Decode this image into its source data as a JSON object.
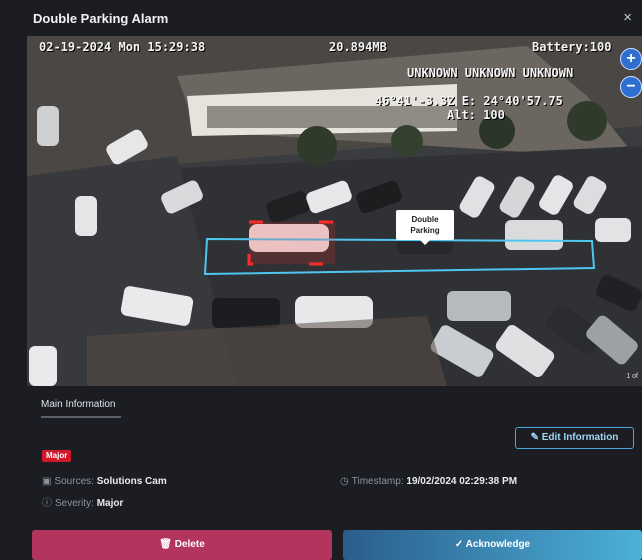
{
  "window": {
    "title": "Double Parking Alarm",
    "close_label": "×"
  },
  "camera": {
    "osd_datetime": "02-19-2024 Mon 15:29:38",
    "osd_size": "20.894MB",
    "osd_battery": "Battery:100",
    "osd_status": "UNKNOWN UNKNOWN UNKNOWN",
    "osd_coords": "46°41'-3.3Z E: 24°40'57.75",
    "osd_alt": "Alt: 100",
    "zoom_in": "+",
    "zoom_out": "−",
    "page_indicator": "1 of",
    "detection_label": "Double Parking",
    "highlight_color": "#ff2b2b",
    "zone_color": "#4fc6f0"
  },
  "tabs": {
    "main_info": "Main Information"
  },
  "actions": {
    "edit": "Edit Information",
    "delete": "Delete",
    "acknowledge": "Acknowledge"
  },
  "alarm": {
    "badge": "Major",
    "sources_label": "Sources:",
    "sources_value": "Solutions Cam",
    "severity_label": "Severity:",
    "severity_value": "Major",
    "timestamp_label": "Timestamp:",
    "timestamp_value": "19/02/2024 02:29:38 PM"
  },
  "icons": {
    "edit": "pencil-icon",
    "delete": "trash-icon",
    "ack": "check-icon",
    "source": "camera-icon",
    "severity": "info-icon",
    "timestamp": "clock-icon"
  }
}
